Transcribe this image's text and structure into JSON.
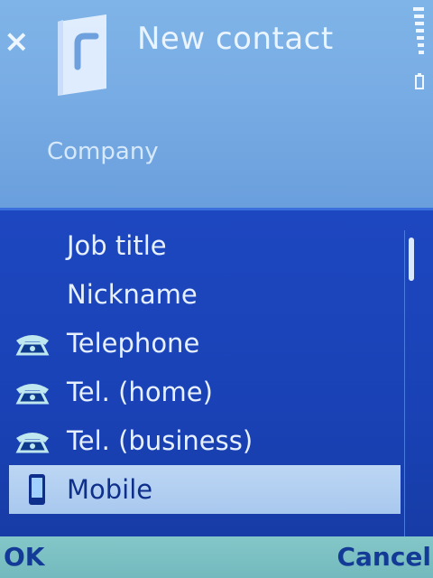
{
  "header": {
    "close_label": "×",
    "title": "New contact",
    "field": "Company",
    "icon": "contact-card-icon"
  },
  "list": {
    "items": [
      {
        "label": "Job title",
        "icon": ""
      },
      {
        "label": "Nickname",
        "icon": ""
      },
      {
        "label": "Telephone",
        "icon": "telephone-icon"
      },
      {
        "label": "Tel. (home)",
        "icon": "telephone-icon"
      },
      {
        "label": "Tel. (business)",
        "icon": "telephone-icon"
      },
      {
        "label": "Mobile",
        "icon": "mobile-phone-icon",
        "selected": true
      }
    ]
  },
  "softkeys": {
    "left": "OK",
    "right": "Cancel"
  },
  "colors": {
    "header_bg": "#78ace4",
    "list_bg": "#1a42b6",
    "selection_bg": "#b3cff1",
    "softkey_bg": "#7cc0c3",
    "softkey_text": "#123a96"
  }
}
